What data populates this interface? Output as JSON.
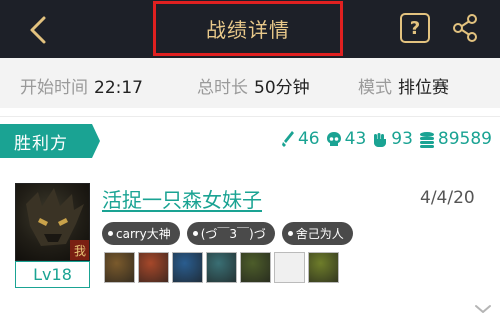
{
  "header": {
    "title": "战绩详情",
    "help_label": "?"
  },
  "info": {
    "start_label": "开始时间",
    "start_value": "22:17",
    "duration_label": "总时长",
    "duration_value": "50分钟",
    "mode_label": "模式",
    "mode_value": "排位赛"
  },
  "team": {
    "label": "胜利方",
    "kills": "46",
    "deaths": "43",
    "assists": "93",
    "gold": "89589"
  },
  "player": {
    "name": "活捉一只森女妹子",
    "date": "4/4/20",
    "level": "Lv18",
    "tags": [
      "carry大神",
      "(づ￣3￣)づ",
      "舍己为人"
    ]
  },
  "items": [
    {
      "name": "item-slot-1",
      "color": "#7a5a2c"
    },
    {
      "name": "item-slot-2",
      "color": "#a6482a"
    },
    {
      "name": "item-slot-3",
      "color": "#2a5d8f"
    },
    {
      "name": "item-slot-4",
      "color": "#3a6f74"
    },
    {
      "name": "item-slot-5",
      "color": "#4d5d2a"
    },
    {
      "name": "item-slot-empty",
      "color": "#f0f0f0"
    },
    {
      "name": "item-slot-trinket",
      "color": "#6e7d2a"
    }
  ],
  "colors": {
    "accent": "#1aa393",
    "header_bg": "#1d2028",
    "gold_text": "#e9c98a",
    "highlight": "#e02020"
  }
}
